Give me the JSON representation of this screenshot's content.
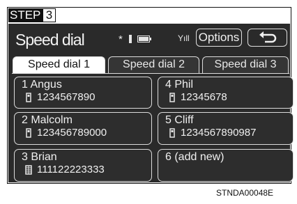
{
  "step": {
    "label": "STEP",
    "number": "3"
  },
  "header": {
    "title": "Speed dial",
    "bluetooth_icon": "*",
    "signal_icon": "Yıll",
    "options_label": "Options"
  },
  "tabs": [
    {
      "label": "Speed dial 1",
      "active": true
    },
    {
      "label": "Speed dial 2",
      "active": false
    },
    {
      "label": "Speed dial 3",
      "active": false
    }
  ],
  "entries": [
    {
      "name": "1  Angus",
      "number": "1234567890",
      "icon": "mobile-phone-icon"
    },
    {
      "name": "4  Phil",
      "number": "12345678",
      "icon": "mobile-phone-icon"
    },
    {
      "name": "2  Malcolm",
      "number": "123456789000",
      "icon": "mobile-phone-icon"
    },
    {
      "name": "5  Cliff",
      "number": "1234567890987",
      "icon": "mobile-phone-icon"
    },
    {
      "name": "3  Brian",
      "number": "111122223333",
      "icon": "office-building-icon"
    },
    {
      "name": "6  (add new)",
      "number": "",
      "icon": ""
    }
  ],
  "caption": "STNDA00048E"
}
